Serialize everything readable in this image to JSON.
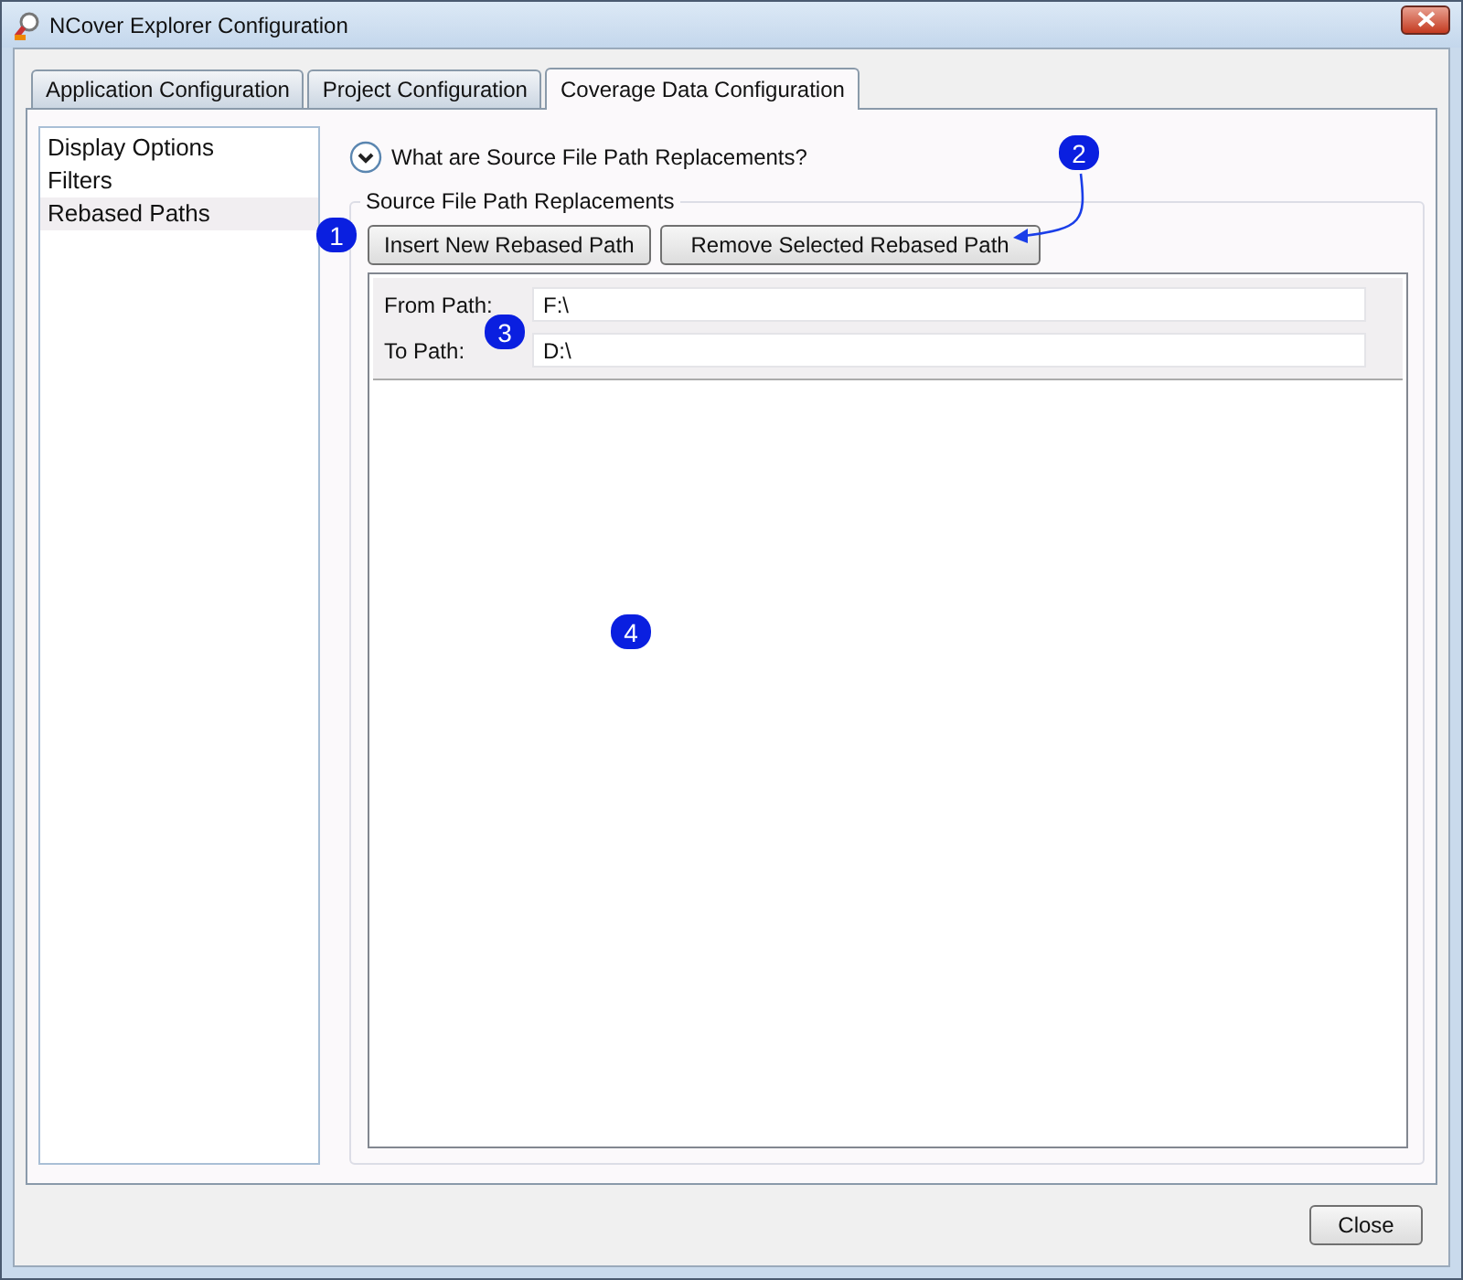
{
  "window": {
    "title": "NCover Explorer Configuration"
  },
  "tabs": [
    {
      "label": "Application Configuration",
      "selected": false
    },
    {
      "label": "Project Configuration",
      "selected": false
    },
    {
      "label": "Coverage Data Configuration",
      "selected": true
    }
  ],
  "sidebar": {
    "items": [
      {
        "label": "Display Options",
        "selected": false
      },
      {
        "label": "Filters",
        "selected": false
      },
      {
        "label": "Rebased Paths",
        "selected": true
      }
    ]
  },
  "help": {
    "label": "What are Source File Path Replacements?",
    "expanded": false
  },
  "group": {
    "title": "Source File Path Replacements",
    "buttons": [
      "Insert New Rebased Path",
      "Remove Selected Rebased Path"
    ],
    "fields": [
      {
        "label": "From Path:",
        "value": "F:\\"
      },
      {
        "label": "To Path:",
        "value": "D:\\"
      }
    ]
  },
  "callouts": [
    "1",
    "2",
    "3",
    "4"
  ],
  "buttons": [
    "Close"
  ]
}
